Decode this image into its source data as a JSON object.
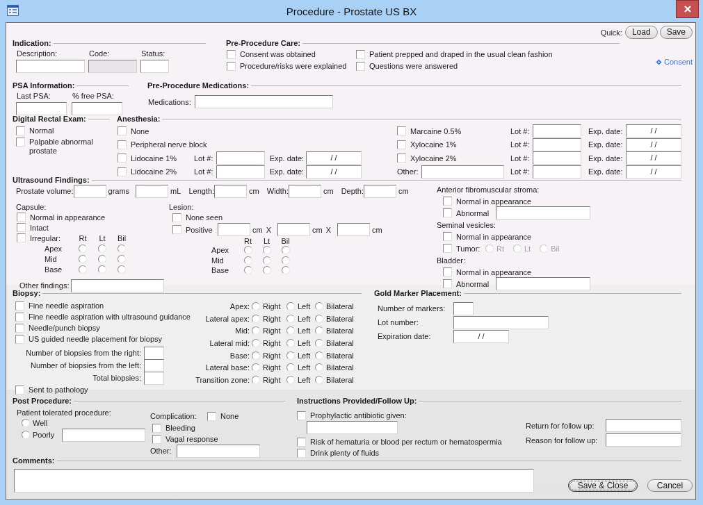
{
  "window": {
    "title": "Procedure - Prostate US BX"
  },
  "quick": {
    "label": "Quick:",
    "buttons": [
      "Load",
      "Save"
    ]
  },
  "indication": {
    "title": "Indication:",
    "fields": [
      {
        "label": "Description:",
        "disabled": false
      },
      {
        "label": "Code:",
        "disabled": true
      },
      {
        "label": "Status:",
        "disabled": false
      }
    ]
  },
  "pre_care": {
    "title": "Pre-Procedure Care:",
    "checks": [
      {
        "label": "Consent was obtained",
        "checked": false
      },
      {
        "label": "Patient prepped and draped in the usual clean fashion",
        "checked": false
      },
      {
        "label": "Procedure/risks were explained",
        "checked": false
      },
      {
        "label": "Questions were answered",
        "checked": false
      }
    ],
    "link": "Consent"
  },
  "psa": {
    "title": "PSA Information:",
    "fields": [
      "Last PSA:",
      "% free PSA:"
    ]
  },
  "pre_meds": {
    "title": "Pre-Procedure Medications:",
    "label": "Medications:"
  },
  "dre": {
    "title": "Digital Rectal Exam:",
    "checks": [
      {
        "label": "Normal",
        "checked": false
      },
      {
        "label": "Palpable abnormal prostate",
        "checked": false
      }
    ]
  },
  "anesthesia": {
    "title": "Anesthesia:",
    "left": [
      {
        "kind": "plain",
        "label": "None",
        "checked": false
      },
      {
        "kind": "plain",
        "label": "Peripheral nerve block",
        "checked": false
      },
      {
        "kind": "lot",
        "label": "Lidocaine 1%",
        "checked": false,
        "lot_label": "Lot #:",
        "exp_label": "Exp. date:",
        "exp_value": "/ /"
      },
      {
        "kind": "lot",
        "label": "Lidocaine 2%",
        "checked": false,
        "lot_label": "Lot #:",
        "exp_label": "Exp. date:",
        "exp_value": "/ /"
      }
    ],
    "right": [
      {
        "kind": "lot",
        "label": "Marcaine 0.5%",
        "checked": false,
        "lot_label": "Lot #:",
        "exp_label": "Exp. date:",
        "exp_value": "/ /"
      },
      {
        "kind": "lot",
        "label": "Xylocaine 1%",
        "checked": false,
        "lot_label": "Lot #:",
        "exp_label": "Exp. date:",
        "exp_value": "/ /"
      },
      {
        "kind": "lot",
        "label": "Xylocaine 2%",
        "checked": false,
        "lot_label": "Lot #:",
        "exp_label": "Exp. date:",
        "exp_value": "/ /"
      },
      {
        "kind": "other",
        "label": "Other:",
        "lot_label": "Lot #:",
        "exp_label": "Exp. date:",
        "exp_value": "/ /"
      }
    ]
  },
  "ultrasound": {
    "title": "Ultrasound Findings:",
    "measures": [
      {
        "label": "Prostate volume:",
        "unit": "grams"
      },
      {
        "unit": "mL"
      },
      {
        "label": "Length:",
        "unit": "cm"
      },
      {
        "label": "Width:",
        "unit": "cm"
      },
      {
        "label": "Depth:",
        "unit": "cm"
      }
    ],
    "capsule": {
      "title": "Capsule:",
      "checks": [
        {
          "label": "Normal in appearance",
          "checked": false
        },
        {
          "label": "Intact",
          "checked": false
        },
        {
          "label": "Irregular:",
          "checked": false
        }
      ],
      "columns": [
        "Rt",
        "Lt",
        "Bil"
      ],
      "rows": [
        {
          "label": "Apex",
          "options": [
            {
              "selected": false
            },
            {
              "selected": false
            },
            {
              "selected": false
            }
          ]
        },
        {
          "label": "Mid",
          "options": [
            {
              "selected": false
            },
            {
              "selected": false
            },
            {
              "selected": false
            }
          ]
        },
        {
          "label": "Base",
          "options": [
            {
              "selected": false
            },
            {
              "selected": false
            },
            {
              "selected": false
            }
          ]
        }
      ]
    },
    "lesion": {
      "title": "Lesion:",
      "none": {
        "label": "None seen",
        "checked": false
      },
      "positive": {
        "label": "Positive",
        "checked": false
      },
      "dims": [
        {
          "unit": "cm",
          "sep": "X"
        },
        {
          "unit": "cm",
          "sep": "X"
        },
        {
          "unit": "cm"
        }
      ],
      "columns": [
        "Rt",
        "Lt",
        "Bil"
      ],
      "rows": [
        {
          "label": "Apex",
          "options": [
            {
              "selected": false
            },
            {
              "selected": false
            },
            {
              "selected": false
            }
          ]
        },
        {
          "label": "Mid",
          "options": [
            {
              "selected": false
            },
            {
              "selected": false
            },
            {
              "selected": false
            }
          ]
        },
        {
          "label": "Base",
          "options": [
            {
              "selected": false
            },
            {
              "selected": false
            },
            {
              "selected": false
            }
          ]
        }
      ]
    },
    "groups": [
      {
        "title": "Anterior fibromuscular stroma:",
        "checks": [
          {
            "kind": "plain",
            "label": "Normal in appearance",
            "checked": false
          },
          {
            "kind": "field",
            "label": "Abnormal",
            "checked": false
          }
        ]
      },
      {
        "title": "Seminal vesicles:",
        "checks": [
          {
            "kind": "plain",
            "label": "Normal in appearance",
            "checked": false
          },
          {
            "kind": "radios",
            "label": "Tumor:",
            "checked": false,
            "options_disabled": true,
            "options": [
              {
                "label": "Rt",
                "selected": false
              },
              {
                "label": "Lt",
                "selected": false
              },
              {
                "label": "Bil",
                "selected": false
              }
            ]
          }
        ]
      },
      {
        "title": "Bladder:",
        "checks": [
          {
            "kind": "plain",
            "label": "Normal in appearance",
            "checked": false
          },
          {
            "kind": "field",
            "label": "Abnormal",
            "checked": false
          }
        ]
      }
    ],
    "other_findings": "Other findings:"
  },
  "biopsy": {
    "title": "Biopsy:",
    "checks": [
      {
        "label": "Fine needle aspiration",
        "checked": false
      },
      {
        "label": "Fine needle aspiration with ultrasound guidance",
        "checked": false
      },
      {
        "label": "Needle/punch biopsy",
        "checked": false
      },
      {
        "label": "US guided needle placement for biopsy",
        "checked": false
      }
    ],
    "counts": [
      "Number of biopsies from the right:",
      "Number of biopsies from the left:",
      "Total biopsies:"
    ],
    "pathology": {
      "label": "Sent to pathology",
      "checked": false
    },
    "zones": [
      {
        "label": "Apex:",
        "options": [
          {
            "label": "Right",
            "selected": false
          },
          {
            "label": "Left",
            "selected": false
          },
          {
            "label": "Bilateral",
            "selected": false
          }
        ]
      },
      {
        "label": "Lateral apex:",
        "options": [
          {
            "label": "Right",
            "selected": false
          },
          {
            "label": "Left",
            "selected": false
          },
          {
            "label": "Bilateral",
            "selected": false
          }
        ]
      },
      {
        "label": "Mid:",
        "options": [
          {
            "label": "Right",
            "selected": false
          },
          {
            "label": "Left",
            "selected": false
          },
          {
            "label": "Bilateral",
            "selected": false
          }
        ]
      },
      {
        "label": "Lateral mid:",
        "options": [
          {
            "label": "Right",
            "selected": false
          },
          {
            "label": "Left",
            "selected": false
          },
          {
            "label": "Bilateral",
            "selected": false
          }
        ]
      },
      {
        "label": "Base:",
        "options": [
          {
            "label": "Right",
            "selected": false
          },
          {
            "label": "Left",
            "selected": false
          },
          {
            "label": "Bilateral",
            "selected": false
          }
        ]
      },
      {
        "label": "Lateral base:",
        "options": [
          {
            "label": "Right",
            "selected": false
          },
          {
            "label": "Left",
            "selected": false
          },
          {
            "label": "Bilateral",
            "selected": false
          }
        ]
      },
      {
        "label": "Transition zone:",
        "options": [
          {
            "label": "Right",
            "selected": false
          },
          {
            "label": "Left",
            "selected": false
          },
          {
            "label": "Bilateral",
            "selected": false
          }
        ]
      }
    ]
  },
  "gold": {
    "title": "Gold Marker Placement:",
    "fields": [
      {
        "kind": "count",
        "label": "Number of markers:"
      },
      {
        "kind": "text",
        "label": "Lot number:"
      },
      {
        "kind": "date",
        "label": "Expiration date:",
        "value": "/ /"
      }
    ]
  },
  "post": {
    "title": "Post Procedure:",
    "tolerated": {
      "label": "Patient tolerated procedure:",
      "options": [
        {
          "label": "Well",
          "selected": false
        },
        {
          "label": "Poorly",
          "selected": false
        }
      ]
    },
    "complication": {
      "label": "Complication:",
      "checks": [
        {
          "label": "None",
          "checked": false
        },
        {
          "label": "Bleeding",
          "checked": false
        },
        {
          "label": "Vagal response",
          "checked": false
        }
      ],
      "other": "Other:"
    }
  },
  "instructions": {
    "title": "Instructions Provided/Follow Up:",
    "checks": [
      {
        "kind": "field",
        "label": "Prophylactic antibiotic given:",
        "checked": false
      },
      {
        "kind": "plain",
        "label": "Risk of hematuria or blood per rectum or hematospermia",
        "checked": false
      },
      {
        "kind": "plain",
        "label": "Drink plenty of fluids",
        "checked": false
      }
    ],
    "follow_up": [
      "Return for follow up:",
      "Reason for follow up:"
    ]
  },
  "comments": {
    "title": "Comments:"
  },
  "buttons": [
    {
      "label": "Save & Close",
      "default": true
    },
    {
      "label": "Cancel",
      "default": false
    }
  ]
}
